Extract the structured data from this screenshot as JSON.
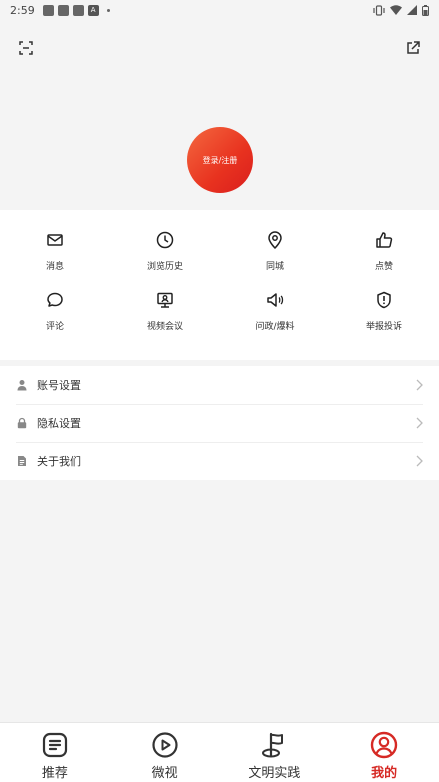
{
  "status_bar": {
    "time": "2:59",
    "notification_badge": "A"
  },
  "header": {
    "login_button_label": "登录/注册",
    "accent_gradient": [
      "#f4683f",
      "#d91e1e"
    ]
  },
  "grid": {
    "items": [
      {
        "label": "消息",
        "icon": "mail-icon"
      },
      {
        "label": "浏览历史",
        "icon": "clock-icon"
      },
      {
        "label": "同城",
        "icon": "location-pin-icon"
      },
      {
        "label": "点赞",
        "icon": "thumbs-up-icon"
      },
      {
        "label": "评论",
        "icon": "comment-icon"
      },
      {
        "label": "视频会议",
        "icon": "video-conference-icon"
      },
      {
        "label": "问政/爆料",
        "icon": "megaphone-icon"
      },
      {
        "label": "举报投诉",
        "icon": "report-shield-icon"
      }
    ]
  },
  "settings_list": {
    "items": [
      {
        "label": "账号设置",
        "icon": "user-icon"
      },
      {
        "label": "隐私设置",
        "icon": "lock-icon"
      },
      {
        "label": "关于我们",
        "icon": "document-icon"
      }
    ]
  },
  "tab_bar": {
    "tabs": [
      {
        "label": "推荐",
        "icon": "list-doc-icon",
        "active": false
      },
      {
        "label": "微视",
        "icon": "play-circle-icon",
        "active": false
      },
      {
        "label": "文明实践",
        "icon": "flag-icon",
        "active": false
      },
      {
        "label": "我的",
        "icon": "user-circle-icon",
        "active": true
      }
    ],
    "active_color": "#d62a25"
  }
}
